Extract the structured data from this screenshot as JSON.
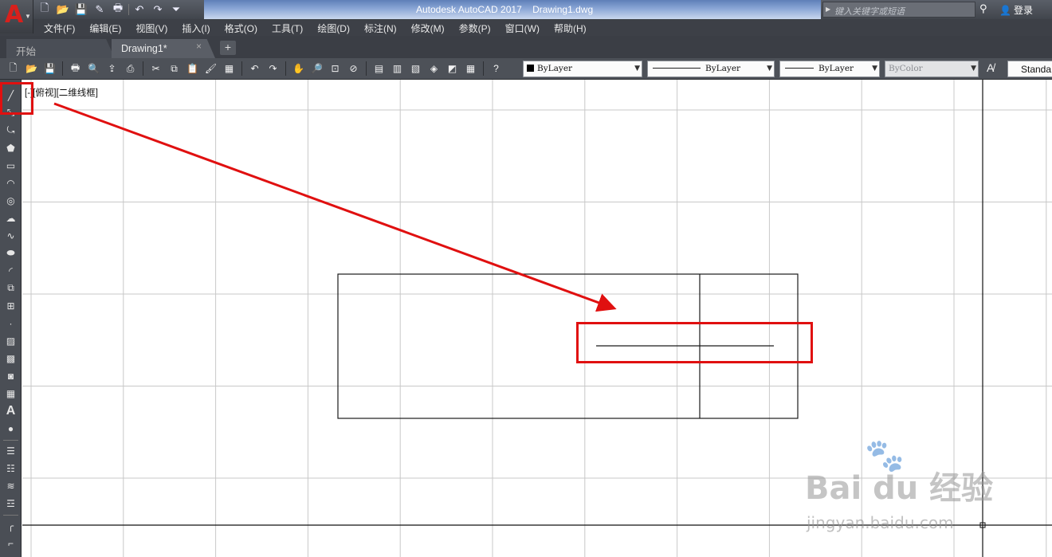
{
  "app": {
    "logo_letter": "A",
    "window_title": "Autodesk AutoCAD 2017    Drawing1.dwg",
    "search_placeholder": "键入关键字或短语",
    "login_label": "登录"
  },
  "quick_access": {
    "icons": [
      "new-icon",
      "open-icon",
      "save-icon",
      "save-as-icon",
      "plot-icon",
      "undo-icon",
      "redo-icon",
      "customize-icon"
    ],
    "glyphs": [
      "🗋",
      "📂",
      "💾",
      "✎",
      "🖶",
      "↶",
      "↷",
      "⏷"
    ]
  },
  "menubar": {
    "items": [
      "文件(F)",
      "编辑(E)",
      "视图(V)",
      "插入(I)",
      "格式(O)",
      "工具(T)",
      "绘图(D)",
      "标注(N)",
      "修改(M)",
      "参数(P)",
      "窗口(W)",
      "帮助(H)"
    ]
  },
  "tabs": {
    "start_label": "开始",
    "drawing_label": "Drawing1*",
    "close_glyph": "×",
    "add_glyph": "+"
  },
  "toolbar": {
    "color_value": "ByLayer",
    "linetype_value": "ByLayer",
    "lineweight_value": "ByLayer",
    "plotstyle_value": "ByColor",
    "textstyle_value": "Standa",
    "tool_icons": [
      "qnew-icon",
      "open-icon",
      "save-icon",
      "plot-icon",
      "plot-preview-icon",
      "publish-icon",
      "3d-print-icon",
      "cut-icon",
      "copy-icon",
      "paste-icon",
      "match-properties-icon",
      "block-editor-icon",
      "undo-icon",
      "redo-icon",
      "pan-icon",
      "zoom-realtime-icon",
      "zoom-window-icon",
      "zoom-previous-icon",
      "properties-icon",
      "design-center-icon",
      "tool-palettes-icon",
      "sheet-set-icon",
      "markup-icon",
      "quickcalc-icon",
      "help-icon"
    ],
    "tool_glyphs": [
      "🗋",
      "📂",
      "💾",
      "🖶",
      "🔍",
      "⇪",
      "⎙",
      "✂",
      "⧉",
      "📋",
      "🖌",
      "▦",
      "↶",
      "↷",
      "✋",
      "🔎",
      "⊡",
      "⊘",
      "▤",
      "▥",
      "▧",
      "◈",
      "◩",
      "▦",
      "?"
    ]
  },
  "left_toolbar": {
    "icons": [
      "line-icon",
      "construction-line-icon",
      "polyline-icon",
      "polygon-icon",
      "rectangle-icon",
      "arc-icon",
      "circle-icon",
      "revision-cloud-icon",
      "spline-icon",
      "ellipse-icon",
      "ellipse-arc-icon",
      "insert-block-icon",
      "make-block-icon",
      "point-icon",
      "hatch-icon",
      "gradient-icon",
      "region-icon",
      "table-icon",
      "multiline-text-icon",
      "add-selected-icon",
      "layer-icon",
      "layer-previous-icon",
      "layer-states-icon",
      "layer-match-icon",
      "fillet-icon",
      "chamfer-icon"
    ],
    "glyphs": [
      "╱",
      "⤡",
      "⤿",
      "⬟",
      "▭",
      "◠",
      "◎",
      "☁",
      "∿",
      "⬬",
      "◜",
      "⧉",
      "⊞",
      "·",
      "▨",
      "▩",
      "◙",
      "▦",
      "A",
      "●",
      "☰",
      "☷",
      "≋",
      "☲",
      "╭",
      "⌐"
    ]
  },
  "canvas": {
    "viewport_label": "[-][俯视][二维线框]"
  },
  "watermark": {
    "text": "Bai du 经验",
    "url": "jingyan.baidu.com"
  },
  "colors": {
    "annotation_red": "#e01010",
    "grid": "#c8c8c8",
    "geometry": "#1a1a1a",
    "autocad_red": "#d8201c"
  }
}
